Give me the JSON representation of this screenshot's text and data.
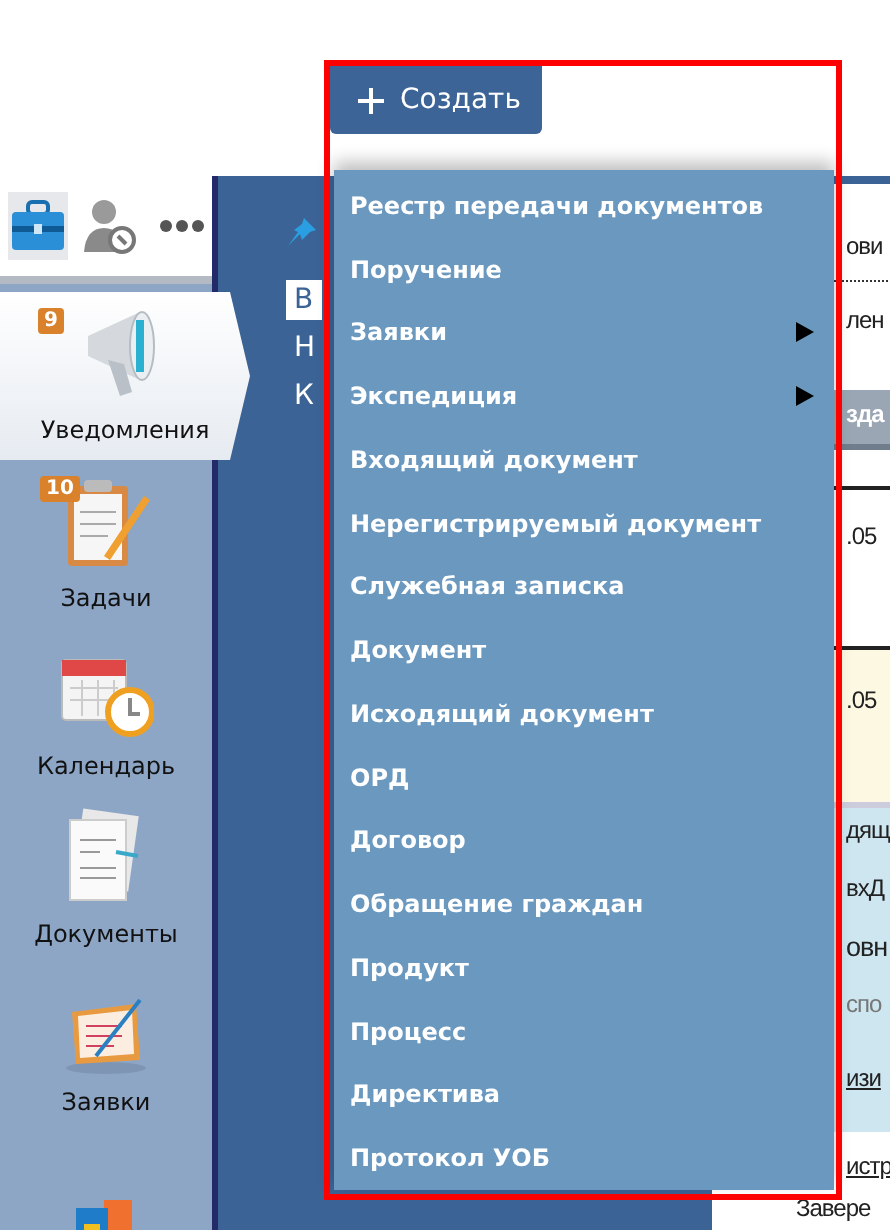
{
  "toolbar": [
    {
      "kind": "briefcase",
      "selected": true
    },
    {
      "kind": "user-settings",
      "selected": false
    },
    {
      "kind": "more",
      "selected": false
    }
  ],
  "sidebar": {
    "items": [
      {
        "kind": "megaphone",
        "label": "Уведомления",
        "badge": "9",
        "selected": true
      },
      {
        "kind": "tasks",
        "label": "Задачи",
        "badge": "10",
        "selected": false
      },
      {
        "kind": "calendar",
        "label": "Календарь",
        "selected": false
      },
      {
        "kind": "document",
        "label": "Документы",
        "selected": false
      },
      {
        "kind": "clipboard",
        "label": "Заявки",
        "selected": false
      },
      {
        "kind": "books",
        "selected": false
      }
    ]
  },
  "panel": {
    "items": [
      {
        "label": "В",
        "selected": true
      },
      {
        "label": "Н",
        "selected": false
      },
      {
        "label": "К",
        "selected": false
      }
    ]
  },
  "content": [
    {
      "kind": "link",
      "text": "ови"
    },
    {
      "kind": "text",
      "text": "лен"
    },
    {
      "kind": "header",
      "text": "зда"
    },
    {
      "kind": "cell",
      "text": ".05"
    },
    {
      "kind": "highlight",
      "text": ".05"
    },
    {
      "kind": "info",
      "text": "дящ"
    },
    {
      "kind": "info",
      "text": "вхД"
    },
    {
      "kind": "heading",
      "text": "овн"
    },
    {
      "kind": "muted",
      "text": "спо"
    },
    {
      "kind": "infolink",
      "text": "изи"
    },
    {
      "kind": "underline",
      "text": "истр"
    },
    {
      "kind": "wide",
      "text": "Завере"
    }
  ],
  "create_button": {
    "label": "Создать"
  },
  "menu": {
    "items": [
      {
        "label": "Реестр передачи документов",
        "submenu": false
      },
      {
        "label": "Поручение",
        "submenu": false
      },
      {
        "label": "Заявки",
        "submenu": true
      },
      {
        "label": "Экспедиция",
        "submenu": true
      },
      {
        "label": "Входящий документ",
        "submenu": false
      },
      {
        "label": "Нерегистрируемый документ",
        "submenu": false
      },
      {
        "label": "Служебная записка",
        "submenu": false
      },
      {
        "label": "Документ",
        "submenu": false
      },
      {
        "label": "Исходящий документ",
        "submenu": false
      },
      {
        "label": "ОРД",
        "submenu": false
      },
      {
        "label": "Договор",
        "submenu": false
      },
      {
        "label": "Обращение граждан",
        "submenu": false
      },
      {
        "label": "Продукт",
        "submenu": false
      },
      {
        "label": "Процесс",
        "submenu": false
      },
      {
        "label": "Директива",
        "submenu": false
      },
      {
        "label": "Протокол УОБ",
        "submenu": false
      }
    ]
  }
}
